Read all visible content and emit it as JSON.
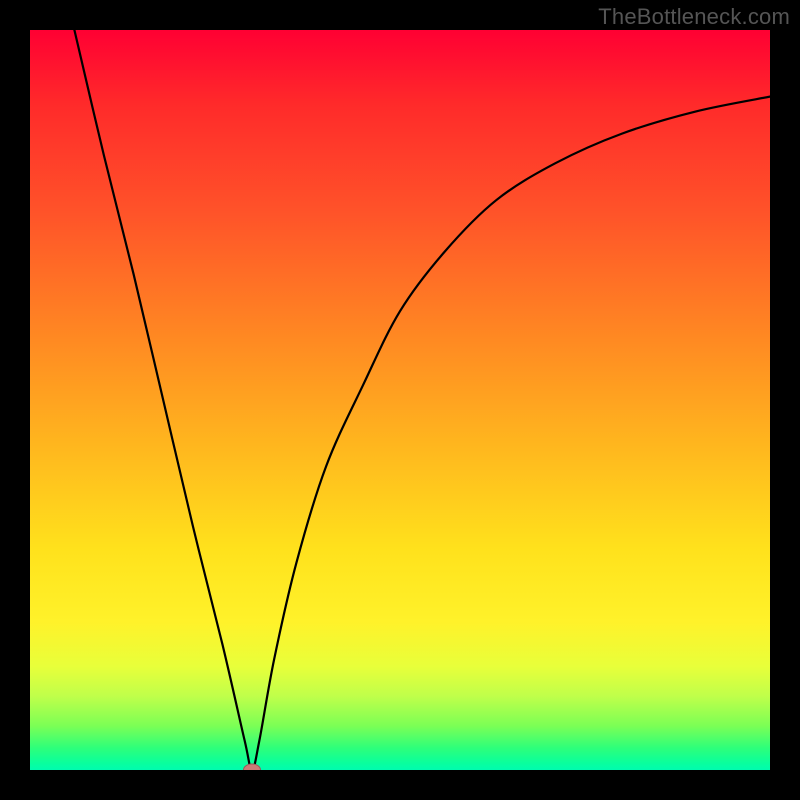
{
  "watermark": "TheBottleneck.com",
  "chart_data": {
    "type": "line",
    "title": "",
    "xlabel": "",
    "ylabel": "",
    "xlim": [
      0,
      1
    ],
    "ylim": [
      0,
      1
    ],
    "grid": false,
    "series": [
      {
        "name": "bottleneck-curve",
        "x": [
          0.06,
          0.1,
          0.14,
          0.18,
          0.22,
          0.26,
          0.29,
          0.3,
          0.31,
          0.33,
          0.36,
          0.4,
          0.45,
          0.5,
          0.56,
          0.63,
          0.71,
          0.8,
          0.9,
          1.0
        ],
        "values": [
          1.0,
          0.83,
          0.67,
          0.5,
          0.33,
          0.17,
          0.04,
          0.0,
          0.04,
          0.15,
          0.28,
          0.41,
          0.52,
          0.62,
          0.7,
          0.77,
          0.82,
          0.86,
          0.89,
          0.91
        ]
      }
    ],
    "marker": {
      "x": 0.3,
      "y": 0.0,
      "color": "#cb7a77"
    },
    "gradient_stops": [
      {
        "pos": 0.0,
        "color": "#ff0033"
      },
      {
        "pos": 0.25,
        "color": "#ff5429"
      },
      {
        "pos": 0.57,
        "color": "#ffb91e"
      },
      {
        "pos": 0.8,
        "color": "#fff22a"
      },
      {
        "pos": 0.94,
        "color": "#7cff55"
      },
      {
        "pos": 1.0,
        "color": "#00fcb0"
      }
    ]
  }
}
